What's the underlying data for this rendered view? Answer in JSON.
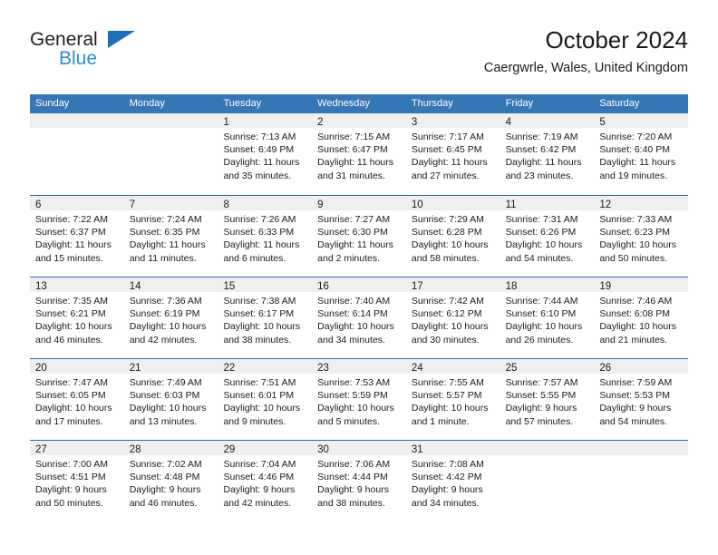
{
  "brand": {
    "name_part1": "General",
    "name_part2": "Blue",
    "color_dark": "#231f20",
    "color_blue": "#2e8bd4",
    "triangle_color": "#1f6fb5"
  },
  "header": {
    "title": "October 2024",
    "subtitle": "Caergwrle, Wales, United Kingdom"
  },
  "theme": {
    "header_bg": "#3576b5",
    "header_text": "#ffffff",
    "week_divider": "#2e6da4",
    "daynum_band_bg": "#efefef",
    "cell_bg": "#ffffff",
    "text": "#1a1a1a"
  },
  "weekday_headers": [
    "Sunday",
    "Monday",
    "Tuesday",
    "Wednesday",
    "Thursday",
    "Friday",
    "Saturday"
  ],
  "weeks": [
    [
      {
        "day": "",
        "lines": []
      },
      {
        "day": "",
        "lines": []
      },
      {
        "day": "1",
        "lines": [
          "Sunrise: 7:13 AM",
          "Sunset: 6:49 PM",
          "Daylight: 11 hours",
          "and 35 minutes."
        ]
      },
      {
        "day": "2",
        "lines": [
          "Sunrise: 7:15 AM",
          "Sunset: 6:47 PM",
          "Daylight: 11 hours",
          "and 31 minutes."
        ]
      },
      {
        "day": "3",
        "lines": [
          "Sunrise: 7:17 AM",
          "Sunset: 6:45 PM",
          "Daylight: 11 hours",
          "and 27 minutes."
        ]
      },
      {
        "day": "4",
        "lines": [
          "Sunrise: 7:19 AM",
          "Sunset: 6:42 PM",
          "Daylight: 11 hours",
          "and 23 minutes."
        ]
      },
      {
        "day": "5",
        "lines": [
          "Sunrise: 7:20 AM",
          "Sunset: 6:40 PM",
          "Daylight: 11 hours",
          "and 19 minutes."
        ]
      }
    ],
    [
      {
        "day": "6",
        "lines": [
          "Sunrise: 7:22 AM",
          "Sunset: 6:37 PM",
          "Daylight: 11 hours",
          "and 15 minutes."
        ]
      },
      {
        "day": "7",
        "lines": [
          "Sunrise: 7:24 AM",
          "Sunset: 6:35 PM",
          "Daylight: 11 hours",
          "and 11 minutes."
        ]
      },
      {
        "day": "8",
        "lines": [
          "Sunrise: 7:26 AM",
          "Sunset: 6:33 PM",
          "Daylight: 11 hours",
          "and 6 minutes."
        ]
      },
      {
        "day": "9",
        "lines": [
          "Sunrise: 7:27 AM",
          "Sunset: 6:30 PM",
          "Daylight: 11 hours",
          "and 2 minutes."
        ]
      },
      {
        "day": "10",
        "lines": [
          "Sunrise: 7:29 AM",
          "Sunset: 6:28 PM",
          "Daylight: 10 hours",
          "and 58 minutes."
        ]
      },
      {
        "day": "11",
        "lines": [
          "Sunrise: 7:31 AM",
          "Sunset: 6:26 PM",
          "Daylight: 10 hours",
          "and 54 minutes."
        ]
      },
      {
        "day": "12",
        "lines": [
          "Sunrise: 7:33 AM",
          "Sunset: 6:23 PM",
          "Daylight: 10 hours",
          "and 50 minutes."
        ]
      }
    ],
    [
      {
        "day": "13",
        "lines": [
          "Sunrise: 7:35 AM",
          "Sunset: 6:21 PM",
          "Daylight: 10 hours",
          "and 46 minutes."
        ]
      },
      {
        "day": "14",
        "lines": [
          "Sunrise: 7:36 AM",
          "Sunset: 6:19 PM",
          "Daylight: 10 hours",
          "and 42 minutes."
        ]
      },
      {
        "day": "15",
        "lines": [
          "Sunrise: 7:38 AM",
          "Sunset: 6:17 PM",
          "Daylight: 10 hours",
          "and 38 minutes."
        ]
      },
      {
        "day": "16",
        "lines": [
          "Sunrise: 7:40 AM",
          "Sunset: 6:14 PM",
          "Daylight: 10 hours",
          "and 34 minutes."
        ]
      },
      {
        "day": "17",
        "lines": [
          "Sunrise: 7:42 AM",
          "Sunset: 6:12 PM",
          "Daylight: 10 hours",
          "and 30 minutes."
        ]
      },
      {
        "day": "18",
        "lines": [
          "Sunrise: 7:44 AM",
          "Sunset: 6:10 PM",
          "Daylight: 10 hours",
          "and 26 minutes."
        ]
      },
      {
        "day": "19",
        "lines": [
          "Sunrise: 7:46 AM",
          "Sunset: 6:08 PM",
          "Daylight: 10 hours",
          "and 21 minutes."
        ]
      }
    ],
    [
      {
        "day": "20",
        "lines": [
          "Sunrise: 7:47 AM",
          "Sunset: 6:05 PM",
          "Daylight: 10 hours",
          "and 17 minutes."
        ]
      },
      {
        "day": "21",
        "lines": [
          "Sunrise: 7:49 AM",
          "Sunset: 6:03 PM",
          "Daylight: 10 hours",
          "and 13 minutes."
        ]
      },
      {
        "day": "22",
        "lines": [
          "Sunrise: 7:51 AM",
          "Sunset: 6:01 PM",
          "Daylight: 10 hours",
          "and 9 minutes."
        ]
      },
      {
        "day": "23",
        "lines": [
          "Sunrise: 7:53 AM",
          "Sunset: 5:59 PM",
          "Daylight: 10 hours",
          "and 5 minutes."
        ]
      },
      {
        "day": "24",
        "lines": [
          "Sunrise: 7:55 AM",
          "Sunset: 5:57 PM",
          "Daylight: 10 hours",
          "and 1 minute."
        ]
      },
      {
        "day": "25",
        "lines": [
          "Sunrise: 7:57 AM",
          "Sunset: 5:55 PM",
          "Daylight: 9 hours",
          "and 57 minutes."
        ]
      },
      {
        "day": "26",
        "lines": [
          "Sunrise: 7:59 AM",
          "Sunset: 5:53 PM",
          "Daylight: 9 hours",
          "and 54 minutes."
        ]
      }
    ],
    [
      {
        "day": "27",
        "lines": [
          "Sunrise: 7:00 AM",
          "Sunset: 4:51 PM",
          "Daylight: 9 hours",
          "and 50 minutes."
        ]
      },
      {
        "day": "28",
        "lines": [
          "Sunrise: 7:02 AM",
          "Sunset: 4:48 PM",
          "Daylight: 9 hours",
          "and 46 minutes."
        ]
      },
      {
        "day": "29",
        "lines": [
          "Sunrise: 7:04 AM",
          "Sunset: 4:46 PM",
          "Daylight: 9 hours",
          "and 42 minutes."
        ]
      },
      {
        "day": "30",
        "lines": [
          "Sunrise: 7:06 AM",
          "Sunset: 4:44 PM",
          "Daylight: 9 hours",
          "and 38 minutes."
        ]
      },
      {
        "day": "31",
        "lines": [
          "Sunrise: 7:08 AM",
          "Sunset: 4:42 PM",
          "Daylight: 9 hours",
          "and 34 minutes."
        ]
      },
      {
        "day": "",
        "lines": []
      },
      {
        "day": "",
        "lines": []
      }
    ]
  ]
}
